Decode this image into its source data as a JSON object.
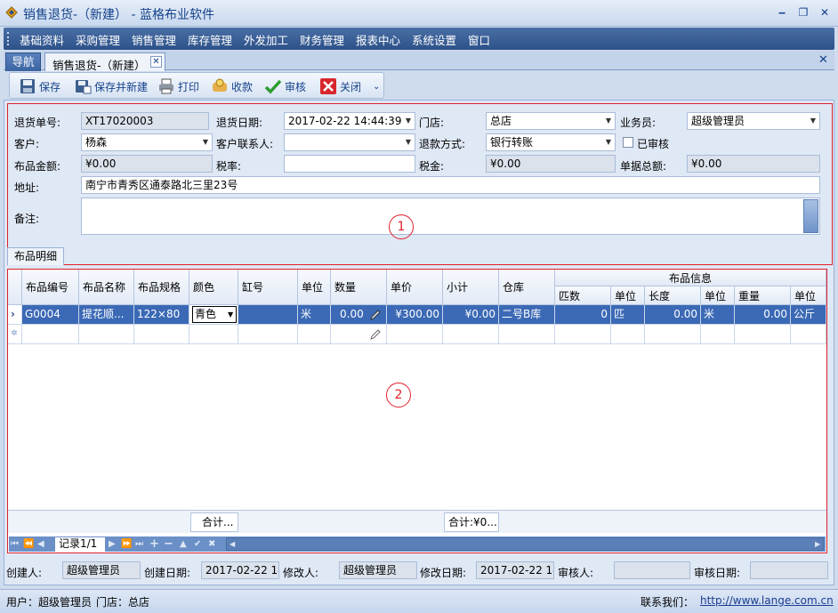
{
  "window": {
    "title": "销售退货-（新建） - 蓝格布业软件",
    "minimize": "‒",
    "restore": "❐",
    "close": "✕"
  },
  "menu": [
    "基础资料",
    "采购管理",
    "销售管理",
    "库存管理",
    "外发加工",
    "财务管理",
    "报表中心",
    "系统设置",
    "窗口"
  ],
  "tabs": {
    "nav": "导航",
    "doc": "销售退货-（新建）",
    "doc_close": "✕",
    "close_all": "✕"
  },
  "toolbar": {
    "save": "保存",
    "save_new": "保存并新建",
    "print": "打印",
    "receive": "收款",
    "audit": "审核",
    "close": "关闭",
    "more": "⌄"
  },
  "form": {
    "order_no_label": "退货单号:",
    "order_no": "XT17020003",
    "date_label": "退货日期:",
    "date": "2017-02-22 14:44:39",
    "store_label": "门店:",
    "store": "总店",
    "salesman_label": "业务员:",
    "salesman": "超级管理员",
    "customer_label": "客户:",
    "customer": "杨森",
    "contact_label": "客户联系人:",
    "contact": "",
    "refund_label": "退款方式:",
    "refund": "银行转账",
    "audited_label": "已审核",
    "amount_label": "布品金额:",
    "amount": "¥0.00",
    "tax_rate_label": "税率:",
    "tax_rate": "",
    "tax_label": "税金:",
    "tax": "¥0.00",
    "total_label": "单据总额:",
    "total": "¥0.00",
    "address_label": "地址:",
    "address": "南宁市青秀区通泰路北三里23号",
    "remark_label": "备注:",
    "remark": "",
    "marker1": "1"
  },
  "subtab": "布品明细",
  "grid": {
    "group_header": "布品信息",
    "columns": [
      "布品编号",
      "布品名称",
      "布品规格",
      "颜色",
      "缸号",
      "单位",
      "数量",
      "单价",
      "小计",
      "仓库",
      "匹数",
      "单位",
      "长度",
      "单位",
      "重量",
      "单位"
    ],
    "row": [
      "G0004",
      "提花顺...",
      "122×80",
      "青色",
      "",
      "米",
      "0.00",
      "¥300.00",
      "¥0.00",
      "二号B库",
      "0",
      "匹",
      "0.00",
      "米",
      "0.00",
      "公斤"
    ],
    "row_indicator": "›",
    "new_row_indicator": "✲",
    "sum1": "合计...",
    "sum2": "合计:¥0...",
    "marker2": "2",
    "record": "记录1/1"
  },
  "info": {
    "creator_label": "创建人:",
    "creator": "超级管理员",
    "create_date_label": "创建日期:",
    "create_date": "2017-02-22 14",
    "modifier_label": "修改人:",
    "modifier": "超级管理员",
    "modify_date_label": "修改日期:",
    "modify_date": "2017-02-22 14",
    "auditor_label": "审核人:",
    "auditor": "",
    "audit_date_label": "审核日期:",
    "audit_date": ""
  },
  "status": {
    "user": "用户：超级管理员",
    "store": "门店：总店",
    "contact_label": "联系我们：",
    "url": "http://www.lange.com.cn"
  }
}
